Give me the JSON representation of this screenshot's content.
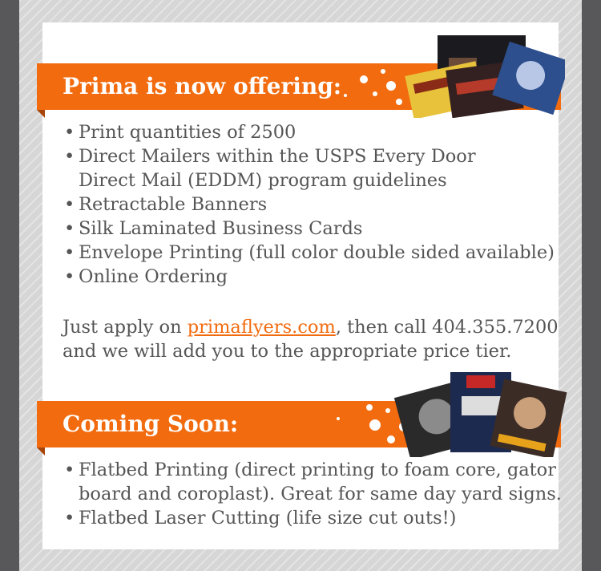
{
  "offering": {
    "title": "Prima is now offering:",
    "items": [
      "Print quantities of 2500",
      "Direct Mailers within the USPS Every Door",
      "Direct Mail (EDDM) program guidelines",
      "Retractable Banners",
      "Silk Laminated Business Cards",
      "Envelope Printing (full color double sided available)",
      "Online Ordering"
    ]
  },
  "cta": {
    "prefix": "Just apply on ",
    "link": "primaflyers.com",
    "suffix": ", then call 404.355.7200",
    "line2": "and we will add you to the appropriate price tier."
  },
  "coming": {
    "title": "Coming Soon:",
    "items": [
      "Flatbed Printing (direct printing to foam core, gator",
      "board and coroplast). Great for same day yard signs.",
      "Flatbed Laser Cutting (life size cut outs!)"
    ]
  },
  "colors": {
    "accent": "#f26b0f",
    "background": "#58585a",
    "text": "#555555"
  },
  "bullet": "•"
}
